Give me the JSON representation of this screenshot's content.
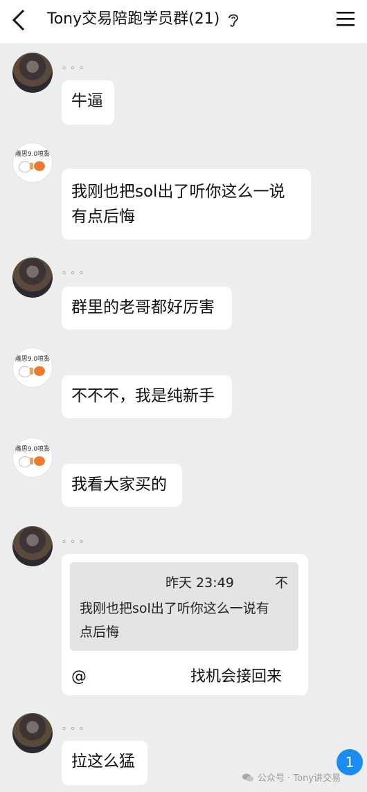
{
  "header": {
    "title": "Tony交易陪跑学员群(21)"
  },
  "messages": [
    {
      "nick": "。。。",
      "text": "牛逼"
    },
    {
      "text": "我刚也把sol出了听你这么一说有点后悔",
      "line1": "我刚也把sol出了听你这么一说",
      "line2": "有点后悔",
      "avatar_label": "雕思9.0喷雾"
    },
    {
      "nick": "。。。",
      "text": "群里的老哥都好厉害"
    },
    {
      "text": "不不不，我是纯新手",
      "avatar_label": "雕思9.0喷雾"
    },
    {
      "text": "我看大家买的",
      "avatar_label": "雕思9.0喷雾"
    },
    {
      "nick": "。。。",
      "quote": {
        "time": "昨天 23:49",
        "pin": "不",
        "line1": "我刚也把sol出了听你这么一说有",
        "line2": "点后悔"
      },
      "reply_at": "@",
      "reply_text": "找机会接回来"
    },
    {
      "nick": "。。。",
      "text": "拉这么猛"
    }
  ],
  "badge": {
    "count": "1"
  },
  "watermark": {
    "text": "公众号 · Tony讲交易"
  },
  "icons": {
    "back": "chevron-left-icon",
    "ear": "ear-icon",
    "menu": "menu-icon",
    "watermark": "wechat-icon"
  },
  "colors": {
    "background": "#ededed",
    "bubble": "#ffffff",
    "badge": "#1a8cf2"
  }
}
